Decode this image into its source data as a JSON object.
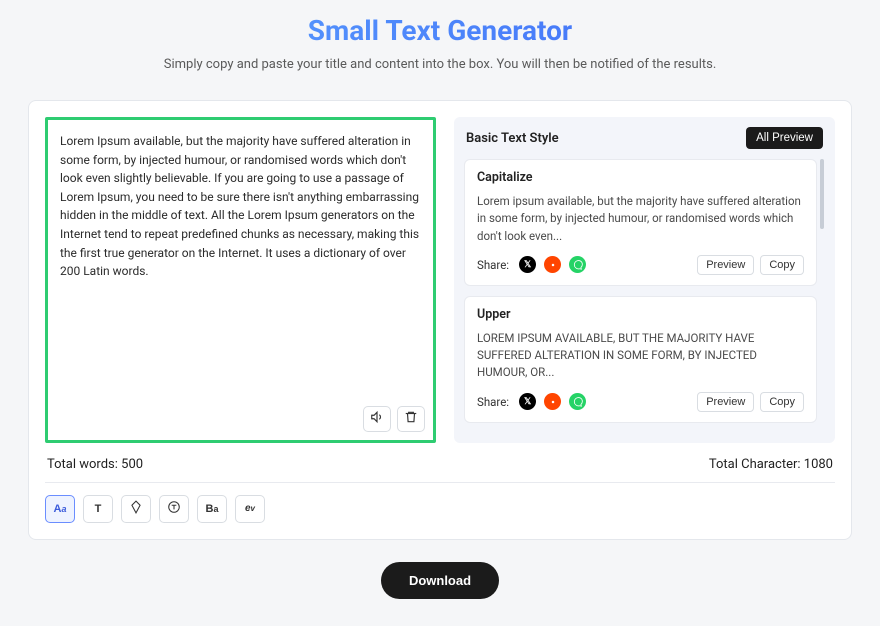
{
  "header": {
    "title": "Small Text Generator",
    "subtitle": "Simply copy and paste your title and content into the box. You will then be notified of the results."
  },
  "input": {
    "text": "Lorem Ipsum available, but the majority have suffered alteration in some form, by injected humour, or randomised words which don't look even slightly believable. If you are going to use a passage of Lorem Ipsum, you need to be sure there isn't anything embarrassing hidden in the middle of text. All the Lorem Ipsum generators on the Internet tend to repeat predefined chunks as necessary, making this the first true generator on the Internet. It uses a dictionary of over 200 Latin words."
  },
  "right": {
    "title": "Basic Text Style",
    "all_preview": "All Preview",
    "share_label": "Share:",
    "preview_btn": "Preview",
    "copy_btn": "Copy",
    "styles": [
      {
        "name": "Capitalize",
        "text": "Lorem ipsum available, but the majority have suffered alteration in some form, by injected humour, or randomised words which don't look even..."
      },
      {
        "name": "Upper",
        "text": "LOREM IPSUM AVAILABLE, BUT THE MAJORITY HAVE SUFFERED ALTERATION IN SOME FORM, BY INJECTED HUMOUR, OR..."
      }
    ]
  },
  "stats": {
    "words_label": "Total words: ",
    "words_value": "500",
    "chars_label": "Total Character: ",
    "chars_value": "1080"
  },
  "toolbar": {
    "items": [
      "Aa",
      "T",
      "diamond",
      "circle-t",
      "Ba",
      "ev"
    ]
  },
  "download": {
    "label": "Download"
  }
}
